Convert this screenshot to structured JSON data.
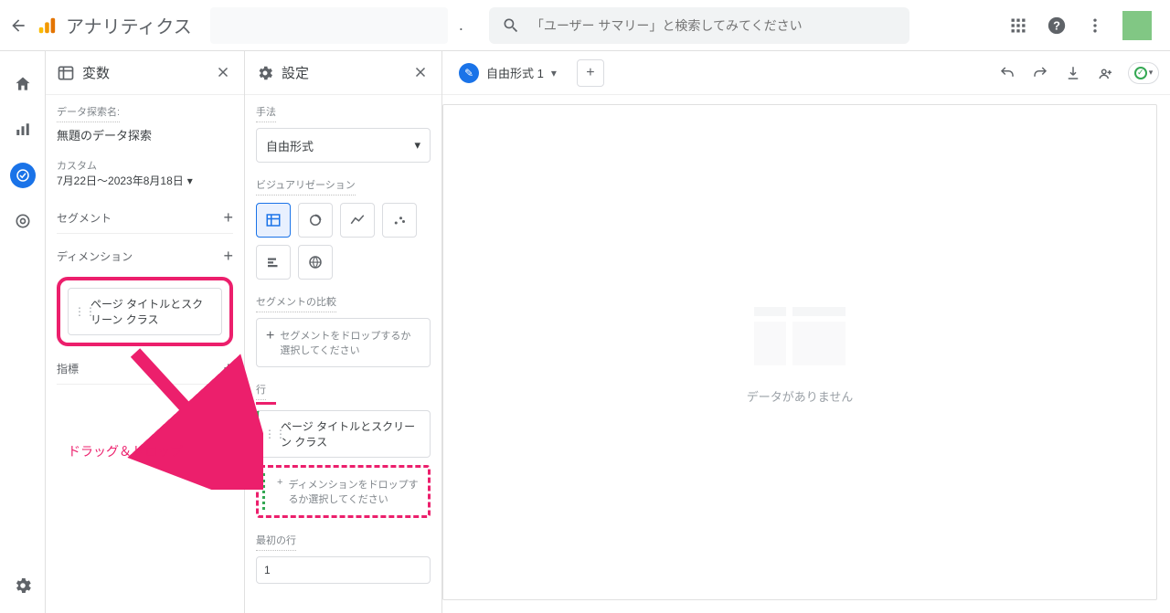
{
  "header": {
    "product_name": "アナリティクス",
    "search_placeholder": "「ユーザー サマリー」と検索してみてください"
  },
  "panel_vars": {
    "title": "変数",
    "exploration_name_label": "データ探索名:",
    "exploration_name": "無題のデータ探索",
    "date_preset": "カスタム",
    "date_range": "7月22日～2023年8月18日",
    "segment_label": "セグメント",
    "dimension_label": "ディメンション",
    "dimension_pill": "ページ タイトルとスクリーン クラス",
    "metric_label": "指標"
  },
  "panel_settings": {
    "title": "設定",
    "technique_label": "手法",
    "technique_value": "自由形式",
    "viz_label": "ビジュアリゼーション",
    "segment_compare_label": "セグメントの比較",
    "segment_drop_text": "セグメントをドロップするか選択してください",
    "rows_label": "行",
    "row_pill": "ページ タイトルとスクリーン クラス",
    "dim_drop_text": "ディメンションをドロップするか選択してください",
    "first_row_label": "最初の行",
    "first_row_value": "1"
  },
  "canvas": {
    "tab_name": "自由形式 1",
    "no_data": "データがありません"
  },
  "annotation": {
    "text": "ドラッグ＆ドロップ"
  }
}
